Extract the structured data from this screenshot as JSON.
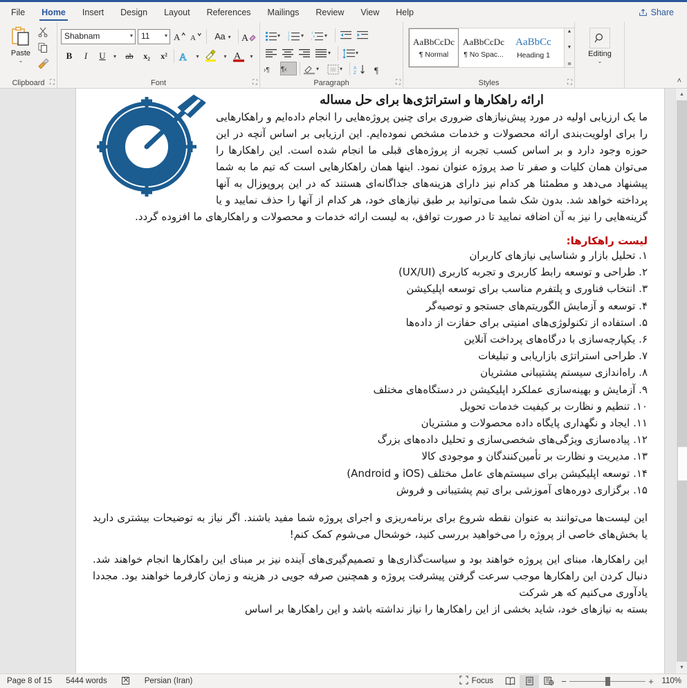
{
  "titlebar": {
    "share_label": "Share",
    "share_icon": "share-icon"
  },
  "tabs": [
    {
      "label": "File",
      "active": false
    },
    {
      "label": "Home",
      "active": true
    },
    {
      "label": "Insert",
      "active": false
    },
    {
      "label": "Design",
      "active": false
    },
    {
      "label": "Layout",
      "active": false
    },
    {
      "label": "References",
      "active": false
    },
    {
      "label": "Mailings",
      "active": false
    },
    {
      "label": "Review",
      "active": false
    },
    {
      "label": "View",
      "active": false
    },
    {
      "label": "Help",
      "active": false
    }
  ],
  "ribbon": {
    "clipboard": {
      "group_label": "Clipboard",
      "paste_label": "Paste",
      "paste_chevron": "⌄",
      "cut_icon": "scissors-icon",
      "copy_icon": "copy-icon",
      "format_painter_icon": "format-painter-icon",
      "dialog_launcher_icon": "dialog-launcher-icon"
    },
    "font": {
      "group_label": "Font",
      "font_name_value": "Shabnam",
      "font_size_value": "11",
      "grow_font_icon": "grow-font-icon",
      "shrink_font_icon": "shrink-font-icon",
      "change_case_label": "Aa",
      "clear_formatting_icon": "clear-formatting-icon",
      "bold_label": "B",
      "italic_label": "I",
      "underline_label": "U",
      "strikethrough_label": "ab",
      "subscript_label": "x₂",
      "superscript_label": "x²",
      "text_effects_icon": "text-effects-icon",
      "highlight_icon": "text-highlight-icon",
      "font_color_icon": "font-color-icon",
      "dialog_launcher_icon": "dialog-launcher-icon"
    },
    "paragraph": {
      "group_label": "Paragraph",
      "bullets_icon": "bullets-icon",
      "numbering_icon": "numbering-icon",
      "multilevel_icon": "multilevel-list-icon",
      "decrease_indent_icon": "decrease-indent-icon",
      "increase_indent_icon": "increase-indent-icon",
      "align_left_icon": "align-left-icon",
      "align_center_icon": "align-center-icon",
      "align_right_icon": "align-right-icon",
      "justify_icon": "justify-icon",
      "line_spacing_icon": "line-spacing-icon",
      "ltr_icon": "left-to-right-text-icon",
      "rtl_icon": "right-to-left-text-icon",
      "shading_icon": "shading-icon",
      "borders_icon": "borders-icon",
      "sort_icon": "sort-icon",
      "show_marks_icon": "pilcrow-icon",
      "dialog_launcher_icon": "dialog-launcher-icon"
    },
    "styles": {
      "group_label": "Styles",
      "items": [
        {
          "sample": "AaBbCcDc",
          "name": "¶ Normal",
          "active": true
        },
        {
          "sample": "AaBbCcDc",
          "name": "¶ No Spac...",
          "active": false
        },
        {
          "sample": "AaBbCс",
          "name": "Heading 1",
          "active": false
        }
      ],
      "scroll_up": "▲",
      "scroll_down": "▼",
      "scroll_more": "≣",
      "dialog_launcher_icon": "dialog-launcher-icon"
    },
    "editing": {
      "group_label": "Editing",
      "label": "Editing",
      "search_icon": "search-icon",
      "chevron": "⌄"
    },
    "collapse_icon": "˄"
  },
  "document": {
    "heading": "ارائه راهکارها و استراتژی‌ها برای حل مساله",
    "image_alt": "target-bullseye-arrow-image",
    "paragraph_1": "ما یک ارزیابی اولیه در مورد پیش‌نیازهای ضروری برای چنین پروژه‌هایی را انجام داده‌ایم و راهکارهایی را برای اولویت‌بندی ارائه محصولات و خدمات مشخص نموده‌ایم. این ارزیابی بر اساس آنچه در این حوزه وجود دارد و بر اساس کسب تجربه از پروژه‌های قبلی ما انجام شده است. این راهکارها را می‌توان همان کلیات و صفر تا صد پروژه عنوان نمود. اینها همان راهکارهایی است که تیم ما به شما پیشنهاد می‌دهد و مطمئنا هر کدام نیز دارای هزینه‌های جداگانه‌ای هستند که در این پروپوزال به آنها پرداخته خواهد شد. بدون شک شما می‌توانید بر طبق نیازهای خود، هر کدام از آنها را حذف نمایید و یا گزینه‌هایی را نیز به آن اضافه نمایید تا در صورت توافق، به لیست ارائه خدمات و محصولات و راهکارهای ما افزوده گردد.",
    "list_title": "لیست راهکارها:",
    "list_title_color": "#c00000",
    "list_items": [
      "۱. تحلیل بازار و شناسایی نیازهای کاربران",
      "۲. طراحی و توسعه رابط کاربری و تجربه کاربری (UX/UI)",
      "۳. انتخاب فناوری و پلتفرم مناسب برای توسعه اپلیکیشن",
      "۴. توسعه و آزمایش الگوریتم‌های جستجو و توصیه‌گر",
      "۵. استفاده از تکنولوژی‌های امنیتی برای حفازت از داده‌ها",
      "۶. یکپارچه‌سازی با درگاه‌های پرداخت آنلاین",
      "۷. طراحی استراتژی بازاریابی و تبلیغات",
      "۸. راه‌اندازی سیستم پشتیبانی مشتریان",
      "۹. آزمایش و بهینه‌سازی عملکرد اپلیکیشن در دستگاه‌های مختلف",
      "۱۰. تنطیم و نظارت بر کیفیت خدمات تحویل",
      "۱۱. ایجاد و نگهداری پایگاه داده محصولات و مشتریان",
      "۱۲. پیاده‌سازی ویژگی‌های شخصی‌سازی و تحلیل داده‌های بزرگ",
      "۱۳. مدیریت و نظارت بر تأمین‌کنندگان و موجودی کالا",
      "۱۴. توسعه اپلیکیشن برای سیستم‌های عامل مختلف (iOS و Android)",
      "۱۵. برگزاری دوره‌های آموزشی برای تیم پشتیبانی و فروش"
    ],
    "paragraph_2": "این لیست‌ها می‌توانند به عنوان نقطه شروع برای برنامه‌ریزی و اجرای پروژه شما مفید باشند. اگر نیاز به توضیحات بیشتری دارید یا بخش‌های خاصی از پروژه را می‌خواهید بررسی کنید، خوشحال می‌شوم کمک کنم!",
    "paragraph_3": "این راهکارها، مبنای این پروژه خواهند بود و سیاست‌گذاری‌ها و تصمیم‌گیری‌های آینده نیز بر مبنای این راهکارها انجام خواهند شد. دنبال کردن این راهکارها موجب سرعت گرفتن پیشرفت پروژه و همچنین صرفه جویی در هزینه و زمان کارفرما خواهند بود. مجددا یادآوری می‌کنیم که هر شرکت",
    "paragraph_4_clipped": "بسته به نیازهای خود، شاید بخشی از این راهکارها را نیاز نداشته باشد و این راهکارها بر اساس"
  },
  "statusbar": {
    "page_info": "Page 8 of 15",
    "word_count": "5444 words",
    "proofing_icon": "proofing-errors-icon",
    "language": "Persian (Iran)",
    "focus_label": "Focus",
    "focus_icon": "focus-mode-icon",
    "read_mode_icon": "read-mode-icon",
    "print_layout_icon": "print-layout-icon",
    "web_layout_icon": "web-layout-icon",
    "zoom_out_label": "−",
    "zoom_in_label": "+",
    "zoom_level": "110%"
  },
  "colors": {
    "accent": "#2b579a",
    "doc_accent_red": "#c00000",
    "target_blue": "#1b5c91"
  }
}
